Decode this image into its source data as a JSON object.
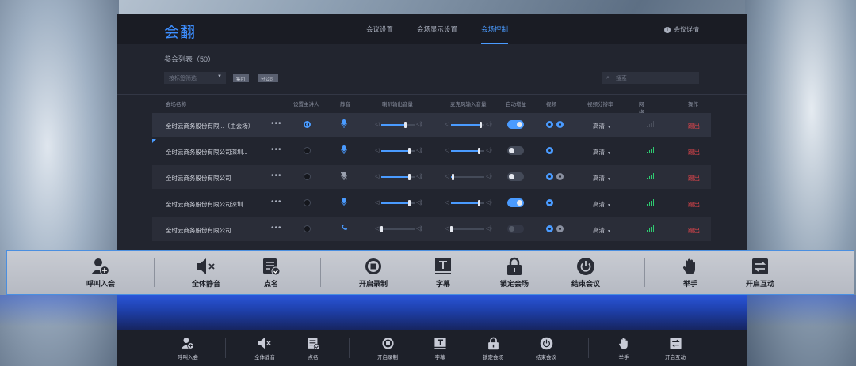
{
  "app": {
    "logo": "会翻",
    "tabs": [
      "会议设置",
      "会场显示设置",
      "会场控制"
    ],
    "active_tab": "会场控制",
    "detail_label": "会议详情"
  },
  "list": {
    "title": "参会列表（50）",
    "filter_placeholder": "按标签筛选",
    "crumbs": [
      "集团",
      "分公司"
    ],
    "search_placeholder": "搜索"
  },
  "table": {
    "headers": [
      "会场名称",
      "设置主讲人",
      "静音",
      "喇叭输出音量",
      "麦克风输入音量",
      "自动增益",
      "视频",
      "视频分辨率",
      "网络情况",
      "操作"
    ],
    "rows": [
      {
        "name": "全时云商务股份有限...（主会场）",
        "presenter": true,
        "mic": "on",
        "speaker": 0.72,
        "micvol": 0.88,
        "agc": true,
        "video": "two",
        "res": "高清",
        "net": "dim",
        "action": "踢出"
      },
      {
        "name": "全时云商务股份有限公司深圳...",
        "presenter": false,
        "mic": "on",
        "speaker": 0.84,
        "micvol": 0.84,
        "agc": false,
        "video": "one",
        "res": "高清",
        "net": "good",
        "action": "踢出"
      },
      {
        "name": "全时云商务股份有限公司",
        "presenter": false,
        "mic": "muted",
        "speaker": 0.84,
        "micvol": 0.04,
        "agc": false,
        "video": "two-gray",
        "res": "高清",
        "net": "good",
        "action": "踢出"
      },
      {
        "name": "全时云商务股份有限公司深圳...",
        "presenter": false,
        "mic": "on",
        "speaker": 0.84,
        "micvol": 0.84,
        "agc": true,
        "video": "one",
        "res": "高清",
        "net": "good",
        "action": "踢出"
      },
      {
        "name": "全时云商务股份有限公司",
        "presenter": false,
        "mic": "phone",
        "speaker": 0.0,
        "micvol": 0.0,
        "agc": "dim",
        "video": "two-gray",
        "res": "高清",
        "net": "good",
        "action": "踢出"
      }
    ]
  },
  "toolbar": {
    "items": [
      {
        "label": "呼叫入会",
        "icon": "add-user-icon"
      },
      {
        "label": "全体静音",
        "icon": "mute-all-icon"
      },
      {
        "label": "点名",
        "icon": "roll-call-icon"
      },
      {
        "label": "开启录制",
        "icon": "record-icon"
      },
      {
        "label": "字幕",
        "icon": "subtitle-icon"
      },
      {
        "label": "锁定会场",
        "icon": "lock-icon"
      },
      {
        "label": "结束会议",
        "icon": "power-icon"
      },
      {
        "label": "举手",
        "icon": "raise-hand-icon"
      },
      {
        "label": "开启互动",
        "icon": "interact-icon"
      }
    ]
  },
  "colors": {
    "accent": "#4a9bff",
    "danger": "#e0454b",
    "network": "#2ecc71",
    "toolbar_border": "#4a8fe0"
  }
}
